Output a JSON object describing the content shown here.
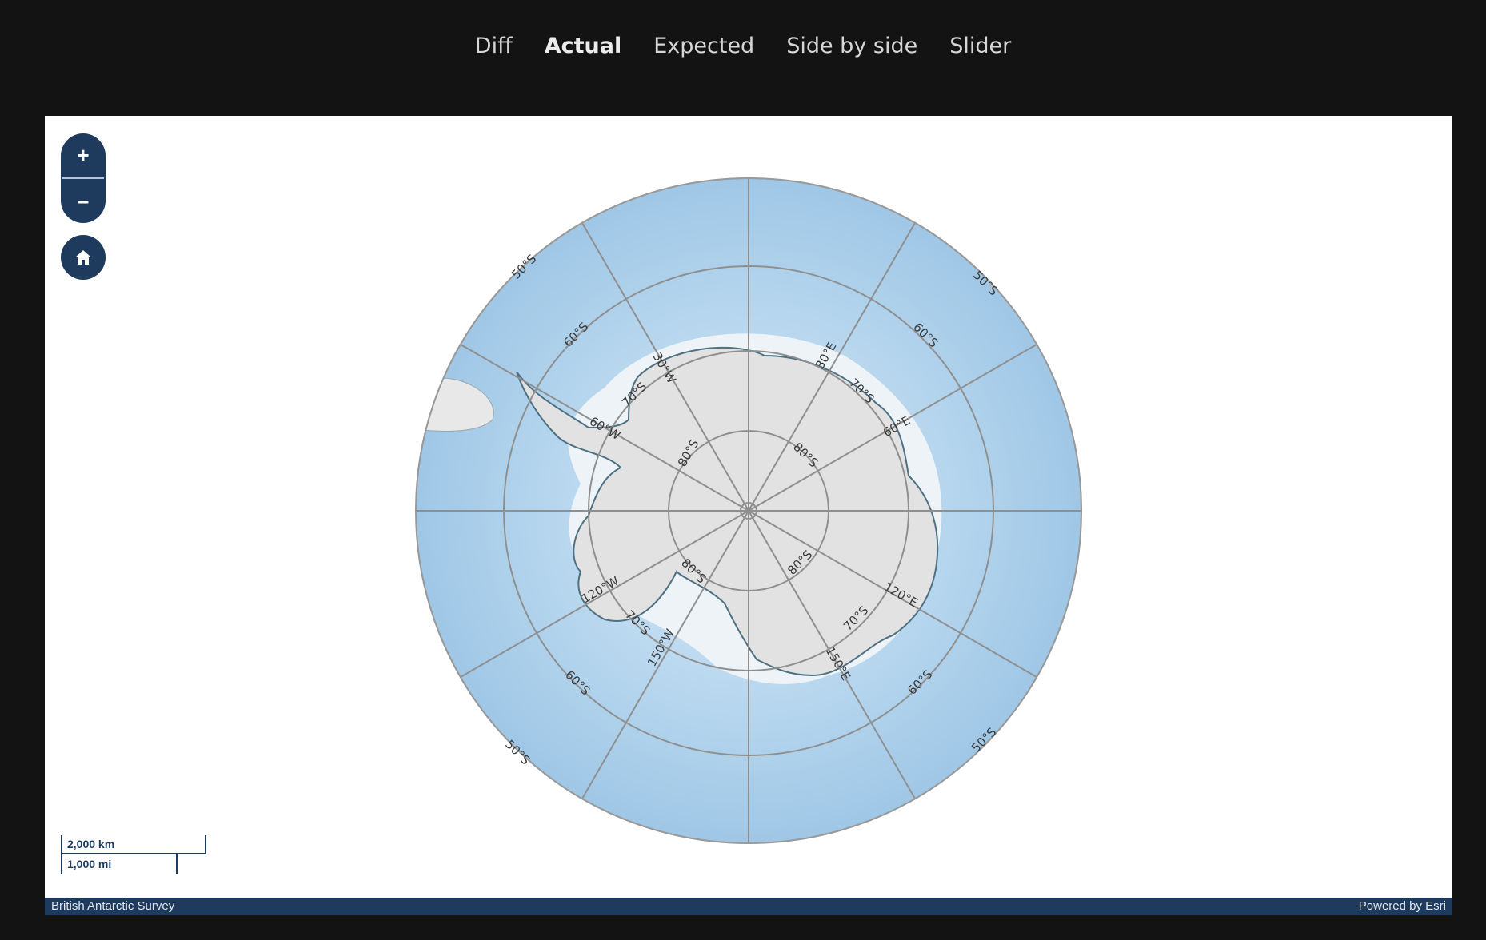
{
  "tabs": [
    {
      "label": "Diff"
    },
    {
      "label": "Actual"
    },
    {
      "label": "Expected"
    },
    {
      "label": "Side by side"
    },
    {
      "label": "Slider"
    }
  ],
  "active_tab": "Actual",
  "map": {
    "zoom_in_label": "+",
    "zoom_out_label": "–",
    "scale": {
      "km": "2,000 km",
      "mi": "1,000 mi"
    },
    "attribution_left": "British Antarctic Survey",
    "attribution_right": "Powered by Esri",
    "graticule_labels": {
      "lat_50_tl": "50°S",
      "lat_50_tr": "50°S",
      "lat_50_bl": "50°S",
      "lat_50_br": "50°S",
      "lat_60_tl": "60°S",
      "lat_60_tr": "60°S",
      "lat_60_bl": "60°S",
      "lat_60_br": "60°S",
      "lat_70_tl": "70°S",
      "lat_70_tr": "70°S",
      "lat_70_bl": "70°S",
      "lat_70_br": "70°S",
      "lat_80_tl": "80°S",
      "lat_80_tr": "80°S",
      "lat_80_bl": "80°S",
      "lat_80_br": "80°S",
      "lon_30w": "30°W",
      "lon_60w": "60°W",
      "lon_120w": "120°W",
      "lon_150w": "150°W",
      "lon_30e": "30°E",
      "lon_60e": "60°E",
      "lon_120e": "120°E",
      "lon_150e": "150°E"
    },
    "colors": {
      "ocean": "#a9cde8",
      "ice": "#e4e4e4",
      "coast": "#4d7082",
      "graticule": "#8f8f8f",
      "control": "#1e3a5c"
    }
  }
}
